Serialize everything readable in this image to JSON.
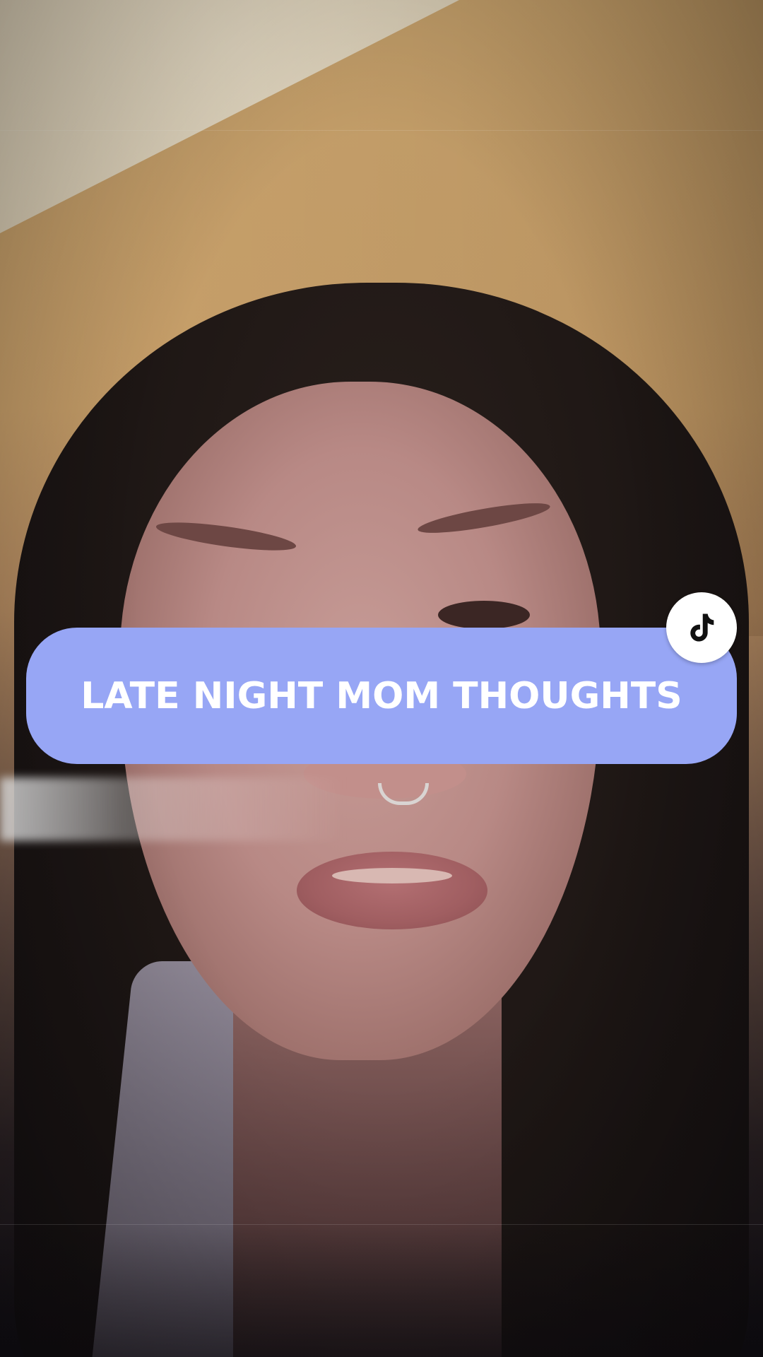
{
  "caption": {
    "text": "LATE NIGHT MOM THOUGHTS",
    "background_color": "#97a6f5",
    "text_color": "#ffffff"
  },
  "logo": {
    "icon": "tiktok-logo-icon",
    "background_color": "#ffffff",
    "icon_color": "#111111"
  }
}
